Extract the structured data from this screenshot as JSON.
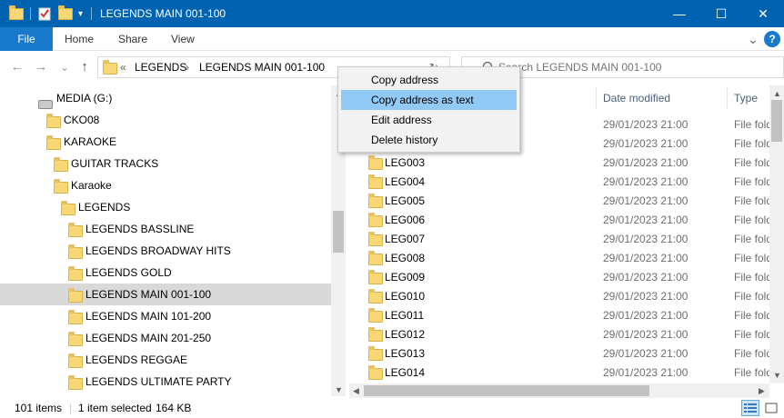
{
  "window": {
    "title": "LEGENDS MAIN 001-100",
    "minimize": "—",
    "maximize": "☐",
    "close": "✕"
  },
  "ribbon": {
    "file": "File",
    "tabs": [
      "Home",
      "Share",
      "View"
    ],
    "collapse_glyph": "⌄",
    "help": "?"
  },
  "nav": {
    "back": "←",
    "forward": "→",
    "recent": "⌄",
    "up": "↑",
    "address_prefix": "«",
    "crumbs": [
      "LEGENDS",
      "LEGENDS MAIN 001-100"
    ],
    "crumb_sep": "›",
    "search_placeholder": "Search LEGENDS MAIN 001-100"
  },
  "tree": {
    "drive": "MEDIA (G:)",
    "items": [
      {
        "label": "CKO08"
      },
      {
        "label": "KARAOKE"
      },
      {
        "label": "GUITAR TRACKS"
      },
      {
        "label": "Karaoke"
      },
      {
        "label": "LEGENDS"
      },
      {
        "label": "LEGENDS BASSLINE"
      },
      {
        "label": "LEGENDS BROADWAY HITS"
      },
      {
        "label": "LEGENDS GOLD"
      },
      {
        "label": "LEGENDS MAIN 001-100"
      },
      {
        "label": "LEGENDS MAIN 101-200"
      },
      {
        "label": "LEGENDS MAIN 201-250"
      },
      {
        "label": "LEGENDS REGGAE"
      },
      {
        "label": "LEGENDS ULTIMATE PARTY"
      }
    ]
  },
  "columns": {
    "date": "Date modified",
    "type": "Type"
  },
  "files": [
    {
      "name": "",
      "date": "29/01/2023 21:00",
      "type": "File folder"
    },
    {
      "name": "",
      "date": "29/01/2023 21:00",
      "type": "File folder"
    },
    {
      "name": "LEG003",
      "date": "29/01/2023 21:00",
      "type": "File folder"
    },
    {
      "name": "LEG004",
      "date": "29/01/2023 21:00",
      "type": "File folder"
    },
    {
      "name": "LEG005",
      "date": "29/01/2023 21:00",
      "type": "File folder"
    },
    {
      "name": "LEG006",
      "date": "29/01/2023 21:00",
      "type": "File folder"
    },
    {
      "name": "LEG007",
      "date": "29/01/2023 21:00",
      "type": "File folder"
    },
    {
      "name": "LEG008",
      "date": "29/01/2023 21:00",
      "type": "File folder"
    },
    {
      "name": "LEG009",
      "date": "29/01/2023 21:00",
      "type": "File folder"
    },
    {
      "name": "LEG010",
      "date": "29/01/2023 21:00",
      "type": "File folder"
    },
    {
      "name": "LEG011",
      "date": "29/01/2023 21:00",
      "type": "File folder"
    },
    {
      "name": "LEG012",
      "date": "29/01/2023 21:00",
      "type": "File folder"
    },
    {
      "name": "LEG013",
      "date": "29/01/2023 21:00",
      "type": "File folder"
    },
    {
      "name": "LEG014",
      "date": "29/01/2023 21:00",
      "type": "File folder"
    }
  ],
  "context_menu": {
    "items": [
      "Copy address",
      "Copy address as text",
      "Edit address",
      "Delete history"
    ],
    "highlighted": "Copy address as text"
  },
  "status": {
    "count": "101 items",
    "selection": "1 item selected",
    "size": "164 KB"
  },
  "colors": {
    "titlebar": "#0063b1",
    "file_tab": "#1979ca",
    "menu_highlight": "#91c9f7",
    "selected_row": "#d9d9d9",
    "folder": "#f8d775"
  }
}
